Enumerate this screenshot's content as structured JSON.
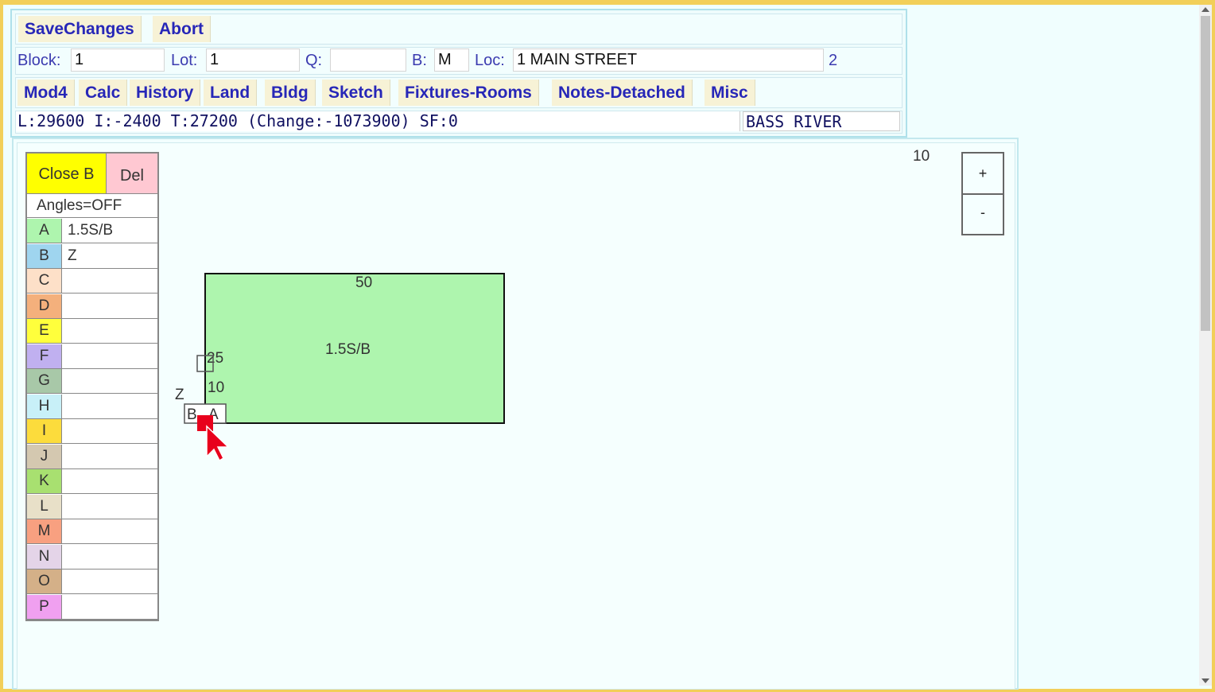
{
  "toolbar": {
    "save_label": "SaveChanges",
    "abort_label": "Abort"
  },
  "record": {
    "block_label": "Block:",
    "block_value": "1",
    "lot_label": "Lot:",
    "lot_value": "1",
    "q_label": "Q:",
    "q_value": "",
    "b_label": "B:",
    "b_value": "M",
    "loc_label": "Loc:",
    "loc_value": "1 MAIN STREET",
    "card_number": "2"
  },
  "tabs": [
    {
      "label": "Mod4"
    },
    {
      "label": "Calc"
    },
    {
      "label": "History"
    },
    {
      "label": "Land"
    },
    {
      "label": "Bldg"
    },
    {
      "label": "Sketch"
    },
    {
      "label": "Fixtures-Rooms"
    },
    {
      "label": "Notes-Detached"
    },
    {
      "label": "Misc"
    }
  ],
  "summary": {
    "values": "L:29600 I:-2400 T:27200 (Change:-1073900) SF:0",
    "district": "BASS RIVER"
  },
  "sketch_panel": {
    "close_label": "Close B",
    "del_label": "Del",
    "angles_label": "Angles=OFF",
    "labels": [
      {
        "key": "A",
        "value": "1.5S/B",
        "color": "#aef5ae"
      },
      {
        "key": "B",
        "value": "Z",
        "color": "#9fd5ef"
      },
      {
        "key": "C",
        "value": "",
        "color": "#fde0c8"
      },
      {
        "key": "D",
        "value": "",
        "color": "#f4b07c"
      },
      {
        "key": "E",
        "value": "",
        "color": "#ffff3c"
      },
      {
        "key": "F",
        "value": "",
        "color": "#c0b0f0"
      },
      {
        "key": "G",
        "value": "",
        "color": "#a8c8a8"
      },
      {
        "key": "H",
        "value": "",
        "color": "#c8f0f8"
      },
      {
        "key": "I",
        "value": "",
        "color": "#fcdc3c"
      },
      {
        "key": "J",
        "value": "",
        "color": "#d4c8b0"
      },
      {
        "key": "K",
        "value": "",
        "color": "#a8e070"
      },
      {
        "key": "L",
        "value": "",
        "color": "#e8e0c8"
      },
      {
        "key": "M",
        "value": "",
        "color": "#f8a080"
      },
      {
        "key": "N",
        "value": "",
        "color": "#e4d4e8"
      },
      {
        "key": "O",
        "value": "",
        "color": "#d4b088"
      },
      {
        "key": "P",
        "value": "",
        "color": "#f0a0f0"
      }
    ],
    "scale": "10",
    "zoom_in": "+",
    "zoom_out": "-"
  },
  "drawing": {
    "area_label": "1.5S/B",
    "dim_top": "50",
    "dim_left": "25",
    "dim_seg": "10",
    "z_label": "Z",
    "point_b": "B",
    "point_a": "A",
    "fill_color": "#aef5ae",
    "cursor_color": "#e8001c"
  }
}
